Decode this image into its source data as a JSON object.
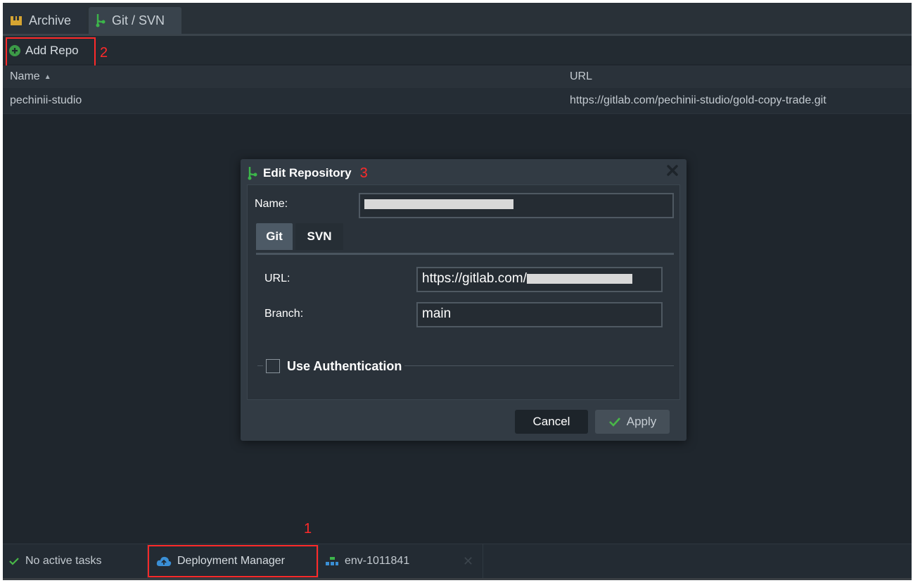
{
  "tabs": [
    {
      "label": "Archive",
      "icon": "archive-icon"
    },
    {
      "label": "Git / SVN",
      "icon": "git-branch-icon"
    }
  ],
  "toolbar": {
    "add_repo_label": "Add Repo",
    "add_repo_icon": "plus-circle-icon"
  },
  "grid": {
    "columns": [
      {
        "label": "Name",
        "sort": "ascending"
      },
      {
        "label": "URL"
      }
    ],
    "rows": [
      {
        "name": "pechinii-studio",
        "url": "https://gitlab.com/pechinii-studio/gold-copy-trade.git"
      }
    ]
  },
  "dialog": {
    "title": "Edit Repository",
    "name_label": "Name:",
    "tabs": [
      "Git",
      "SVN"
    ],
    "active_tab": "Git",
    "url_label": "URL:",
    "url_value_visible": "https://gitlab.com/",
    "branch_label": "Branch:",
    "branch_value": "main",
    "auth_label": "Use Authentication",
    "auth_checked": false,
    "cancel_label": "Cancel",
    "apply_label": "Apply"
  },
  "annotations": {
    "marker_1": "1",
    "marker_2": "2",
    "marker_3": "3",
    "marker_color": "#ff2a2a"
  },
  "statusbar": {
    "tasks_label": "No active tasks",
    "deploy_label": "Deployment Manager",
    "env_label": "env-1011841"
  },
  "colors": {
    "background": "#1f262d",
    "accent_green": "#3cb54a",
    "deploy_blue": "#3a8fd6"
  }
}
